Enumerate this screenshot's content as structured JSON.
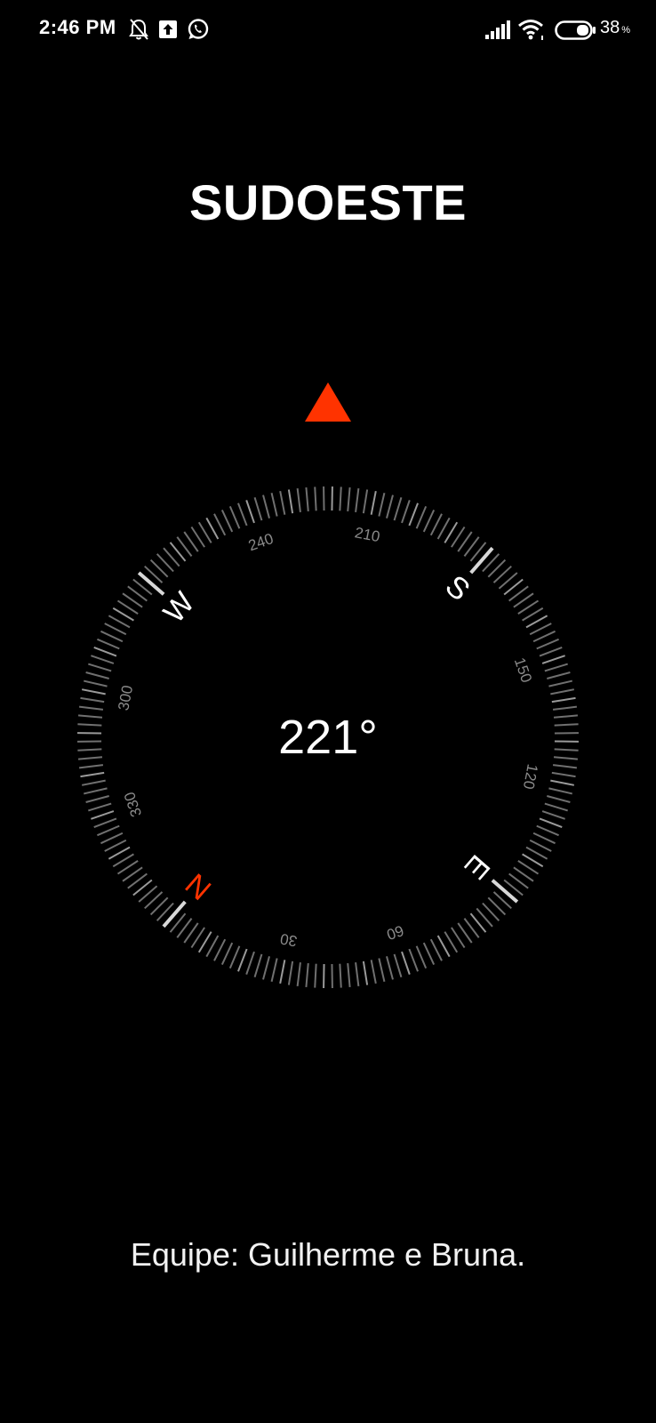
{
  "status_bar": {
    "time": "2:46 PM",
    "battery_percent": "38",
    "battery_unit": "%",
    "icons": [
      "notifications-off-icon",
      "upload-icon",
      "whatsapp-icon",
      "signal-icon",
      "wifi-icon",
      "battery-icon"
    ]
  },
  "compass": {
    "direction_label": "SUDOESTE",
    "heading_degrees": 221,
    "heading_text": "221°",
    "pointer_color": "#ff3300",
    "north_color": "#ff3300",
    "cardinals": [
      {
        "label": "N",
        "bearing": 0
      },
      {
        "label": "E",
        "bearing": 90
      },
      {
        "label": "S",
        "bearing": 180
      },
      {
        "label": "W",
        "bearing": 270
      }
    ],
    "degree_labels": [
      {
        "label": "30",
        "bearing": 30
      },
      {
        "label": "60",
        "bearing": 60
      },
      {
        "label": "120",
        "bearing": 120
      },
      {
        "label": "150",
        "bearing": 150
      },
      {
        "label": "210",
        "bearing": 210
      },
      {
        "label": "240",
        "bearing": 240
      },
      {
        "label": "300",
        "bearing": 300
      },
      {
        "label": "330",
        "bearing": 330
      }
    ]
  },
  "footer": {
    "team_credit": "Equipe: Guilherme e Bruna."
  }
}
